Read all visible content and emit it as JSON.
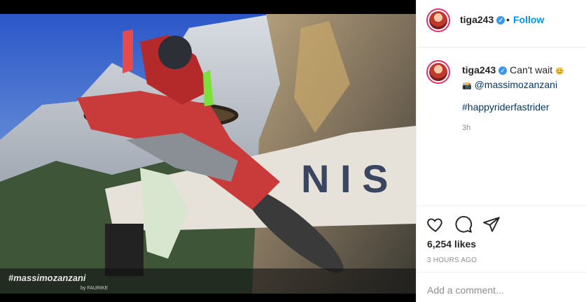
{
  "post": {
    "image_alt_watermark": "#massimozanzani",
    "image_watermark_sub": "by FAURIKE",
    "sign_text": "N I S"
  },
  "header": {
    "username": "tiga243",
    "separator": "•",
    "follow_label": "Follow"
  },
  "caption": {
    "username": "tiga243",
    "text": "Can't wait",
    "emoji": "😊",
    "mention_prefix": "📸",
    "mention": "@massimozanzani",
    "hashtag": "#happyriderfastrider",
    "time": "3h"
  },
  "actions": {
    "like_icon": "heart-icon",
    "comment_icon": "comment-icon",
    "share_icon": "paper-plane-icon"
  },
  "likes": "6,254 likes",
  "timestamp": "3 HOURS AGO",
  "comment": {
    "placeholder": "Add a comment..."
  },
  "colors": {
    "link": "#0095f6",
    "verified": "#3897f0",
    "text": "#262626",
    "muted": "#8e8e8e"
  }
}
